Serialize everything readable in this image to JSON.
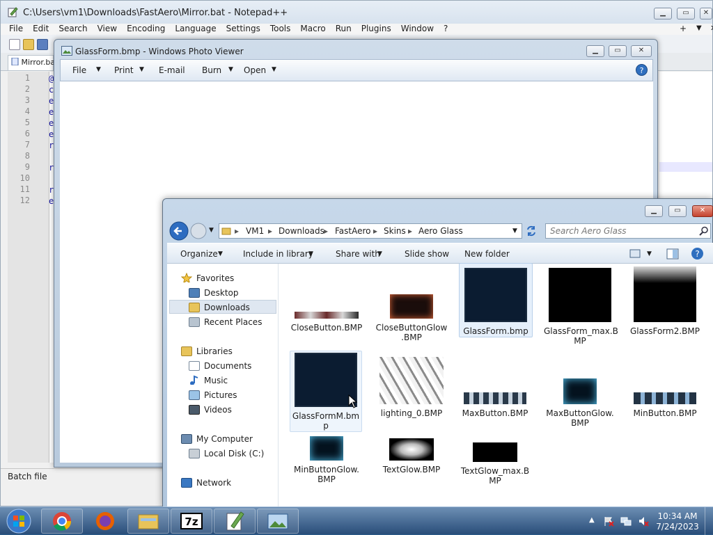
{
  "notepad": {
    "title": "C:\\Users\\vm1\\Downloads\\FastAero\\Mirror.bat - Notepad++",
    "menu": [
      "File",
      "Edit",
      "Search",
      "View",
      "Encoding",
      "Language",
      "Settings",
      "Tools",
      "Macro",
      "Run",
      "Plugins",
      "Window",
      "?"
    ],
    "menu_right": [
      "+",
      "▼",
      "✕"
    ],
    "tab_label": "Mirror.bat",
    "line_numbers": [
      "1",
      "2",
      "3",
      "4",
      "5",
      "6",
      "7",
      "8",
      "9",
      "10",
      "11",
      "12"
    ],
    "code_glyphs": [
      "@",
      "c",
      "e",
      "e",
      "e",
      "e",
      "r",
      "",
      "r",
      "",
      "r",
      "e"
    ],
    "status_text": "Batch file"
  },
  "photo_viewer": {
    "title": "GlassForm.bmp - Windows Photo Viewer",
    "menu": [
      {
        "label": "File",
        "dropdown": true
      },
      {
        "label": "Print",
        "dropdown": true
      },
      {
        "label": "E-mail",
        "dropdown": false
      },
      {
        "label": "Burn",
        "dropdown": true
      },
      {
        "label": "Open",
        "dropdown": true
      }
    ],
    "help_icon": "?"
  },
  "explorer": {
    "breadcrumb": [
      "VM1",
      "Downloads",
      "FastAero",
      "Skins",
      "Aero Glass"
    ],
    "search_placeholder": "Search Aero Glass",
    "commands": [
      {
        "label": "Organize",
        "dropdown": true
      },
      {
        "label": "Include in library",
        "dropdown": true
      },
      {
        "label": "Share with",
        "dropdown": true
      },
      {
        "label": "Slide show",
        "dropdown": false
      },
      {
        "label": "New folder",
        "dropdown": false
      }
    ],
    "nav": {
      "favorites": "Favorites",
      "favorites_items": [
        "Desktop",
        "Downloads",
        "Recent Places"
      ],
      "libraries": "Libraries",
      "libraries_items": [
        "Documents",
        "Music",
        "Pictures",
        "Videos"
      ],
      "computer": "My Computer",
      "computer_items": [
        "Local Disk (C:)"
      ],
      "network": "Network"
    },
    "files": [
      {
        "line1": "CloseButton.BMP",
        "line2": ""
      },
      {
        "line1": "CloseButtonGlow",
        "line2": ".BMP"
      },
      {
        "line1": "GlassForm.bmp",
        "line2": ""
      },
      {
        "line1": "GlassForm_max.B",
        "line2": "MP"
      },
      {
        "line1": "GlassForm2.BMP",
        "line2": ""
      },
      {
        "line1": "GlassFormM.bm",
        "line2": "p"
      },
      {
        "line1": "lighting_0.BMP",
        "line2": ""
      },
      {
        "line1": "MaxButton.BMP",
        "line2": ""
      },
      {
        "line1": "MaxButtonGlow.",
        "line2": "BMP"
      },
      {
        "line1": "MinButton.BMP",
        "line2": ""
      },
      {
        "line1": "MinButtonGlow.",
        "line2": "BMP"
      },
      {
        "line1": "TextGlow.BMP",
        "line2": ""
      },
      {
        "line1": "TextGlow_max.B",
        "line2": "MP"
      }
    ]
  },
  "taskbar": {
    "apps": [
      "Chrome",
      "Firefox",
      "File Explorer",
      "7-Zip",
      "Notepad++",
      "Windows Photo Viewer"
    ],
    "time": "10:34 AM",
    "date": "7/24/2023"
  },
  "colors": {
    "glass_dark": "#0b1c31",
    "selection": "#cce8ff",
    "taskbar_top": "#6d8fb4",
    "taskbar_bottom": "#294d79"
  }
}
